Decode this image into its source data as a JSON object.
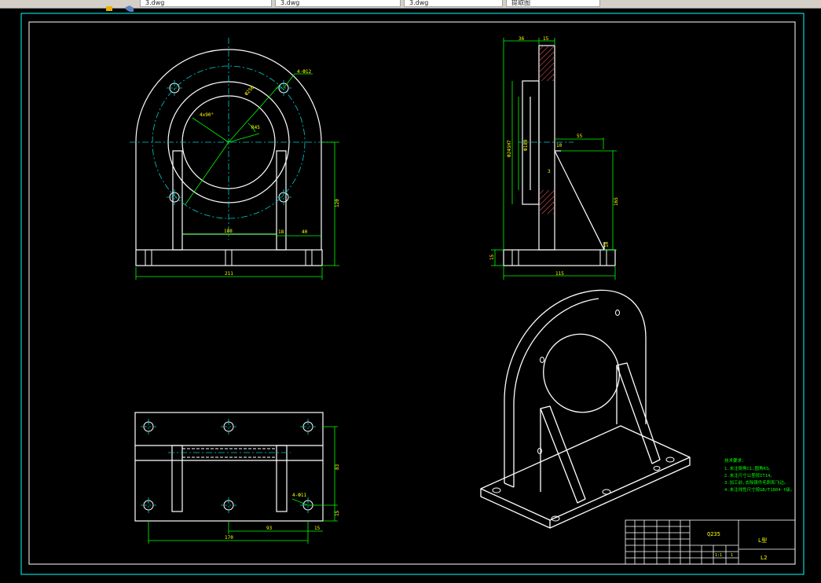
{
  "tabs": [
    {
      "label": "3.dwg"
    },
    {
      "label": "3.dwg"
    },
    {
      "label": "3.dwg"
    },
    {
      "label": "3.dwg"
    },
    {
      "label": "提取图"
    }
  ],
  "drawing": {
    "front_view": {
      "bolt_callout": "4-Ф12",
      "angle_label": "4x90°",
      "dim_bolt_circle": "Ф250",
      "dim_r": "R45",
      "dim_width_inner": "188",
      "dim_rib_thk": "18",
      "dim_rib_off": "40",
      "dim_height": "120",
      "dim_total_width": "211"
    },
    "side_view": {
      "dim_top_left": "36",
      "dim_top_right": "15",
      "dim_bore_outer": "Ф245H7",
      "dim_bore_inner": "Ф180",
      "dim_r": "10",
      "dim_rib_top": "55",
      "dim_rib_height": "165",
      "dim_rib_small": "3",
      "dim_base_thk": "15",
      "dim_rib_foot": "10",
      "dim_total_depth": "115"
    },
    "top_view": {
      "hole_callout": "4-Ф11",
      "dim_depth": "83",
      "dim_edge": "15",
      "dim_pitch": "93",
      "dim_edge2": "15",
      "dim_total": "170"
    },
    "notes": {
      "title": "技术要求:",
      "items": [
        "1.未注倒角C1,圆角R3。",
        "2.未注尺寸公差按IT14。",
        "3.加工前,去除铸件毛刺和飞边。",
        "4.未注线性尺寸按GB/T1804-f级。"
      ]
    },
    "title_block": {
      "material": "Q235",
      "part_name": "L型",
      "drawing_no": "L2",
      "scale": "1:1",
      "sheet": "1"
    }
  },
  "colors": {
    "line": "#ffffff",
    "dim": "#00ff00",
    "center": "#00cccc",
    "text": "#ffff00",
    "border": "#00ffff",
    "hatch": "#ff6060"
  }
}
